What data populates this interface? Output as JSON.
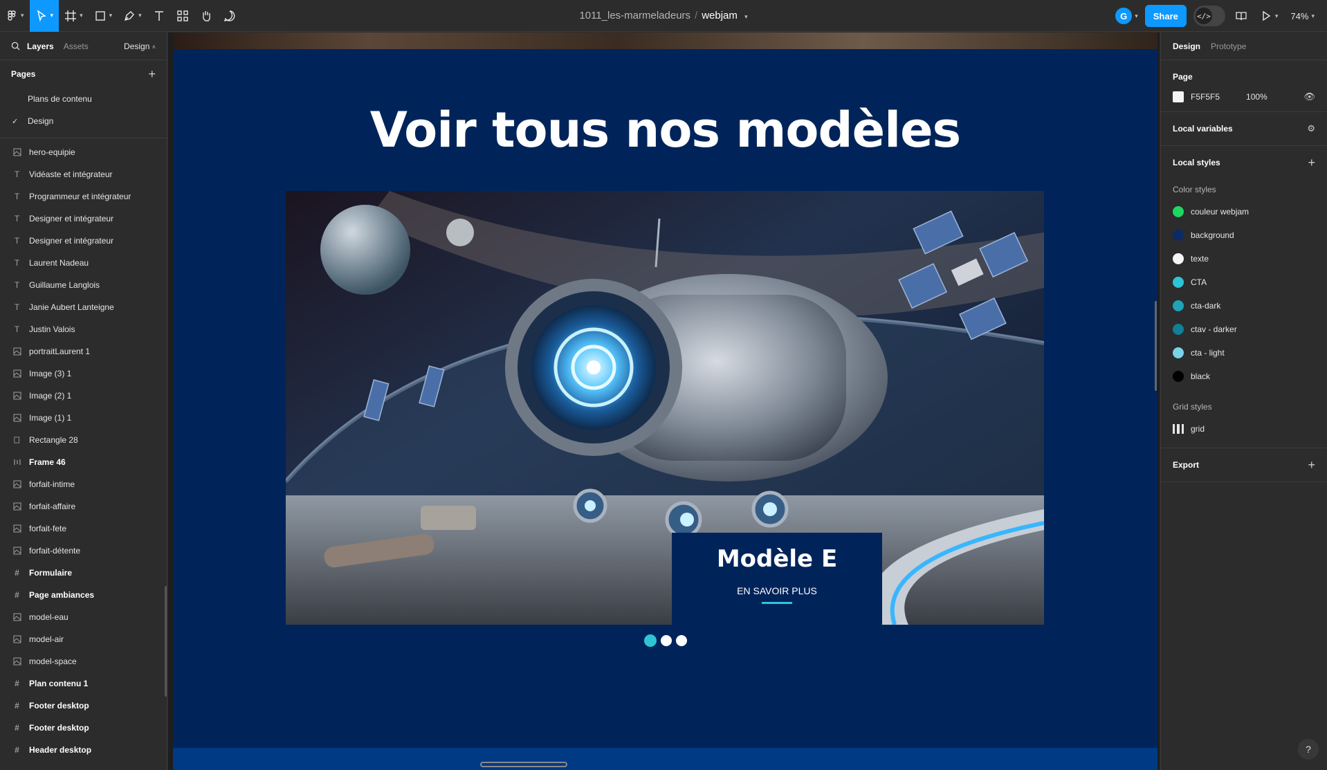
{
  "topbar": {
    "file_project": "1011_les-marmeladeurs",
    "file_name": "webjam",
    "user_initial": "G",
    "share_label": "Share",
    "zoom": "74%"
  },
  "left_panel": {
    "tabs": [
      "Layers",
      "Assets"
    ],
    "mode": "Design",
    "pages_title": "Pages",
    "pages": [
      {
        "label": "Plans de contenu",
        "current": false
      },
      {
        "label": "Design",
        "current": true
      }
    ],
    "layers": [
      {
        "label": "hero-equipie",
        "icon": "image-icon"
      },
      {
        "label": "Vidéaste et intégrateur",
        "icon": "text-icon"
      },
      {
        "label": "Programmeur et intégrateur",
        "icon": "text-icon"
      },
      {
        "label": "Designer et intégrateur",
        "icon": "text-icon"
      },
      {
        "label": "Designer et intégrateur",
        "icon": "text-icon"
      },
      {
        "label": "Laurent Nadeau",
        "icon": "text-icon"
      },
      {
        "label": "Guillaume Langlois",
        "icon": "text-icon"
      },
      {
        "label": "Janie Aubert Lanteigne",
        "icon": "text-icon"
      },
      {
        "label": "Justin Valois",
        "icon": "text-icon"
      },
      {
        "label": "portraitLaurent 1",
        "icon": "image-icon"
      },
      {
        "label": "Image (3) 1",
        "icon": "image-icon"
      },
      {
        "label": "Image (2) 1",
        "icon": "image-icon"
      },
      {
        "label": "Image (1) 1",
        "icon": "image-icon"
      },
      {
        "label": "Rectangle 28",
        "icon": "rectangle-icon"
      },
      {
        "label": "Frame 46",
        "icon": "autolayout-icon",
        "frame": true
      },
      {
        "label": "forfait-intime",
        "icon": "image-icon"
      },
      {
        "label": "forfait-affaire",
        "icon": "image-icon"
      },
      {
        "label": "forfait-fete",
        "icon": "image-icon"
      },
      {
        "label": "forfait-détente",
        "icon": "image-icon"
      },
      {
        "label": "Formulaire",
        "icon": "frame-icon",
        "frame": true
      },
      {
        "label": "Page ambiances",
        "icon": "frame-icon",
        "frame": true
      },
      {
        "label": "model-eau",
        "icon": "image-icon"
      },
      {
        "label": "model-air",
        "icon": "image-icon"
      },
      {
        "label": "model-space",
        "icon": "image-icon"
      },
      {
        "label": "Plan contenu 1",
        "icon": "frame-icon",
        "frame": true
      },
      {
        "label": "Footer desktop",
        "icon": "frame-icon",
        "frame": true
      },
      {
        "label": "Footer desktop",
        "icon": "frame-icon",
        "frame": true
      },
      {
        "label": "Header desktop",
        "icon": "frame-icon",
        "frame": true
      }
    ]
  },
  "canvas": {
    "headline": "Voir tous nos modèles",
    "card_title": "Modèle E",
    "card_link": "EN SAVOIR PLUS",
    "carousel_dots": 3,
    "active_dot": 0,
    "colors": {
      "background": "#00245a",
      "accent": "#2ec4d6",
      "footer": "#003a85"
    }
  },
  "right_panel": {
    "tabs": [
      "Design",
      "Prototype"
    ],
    "page_section": "Page",
    "page_color": "F5F5F5",
    "page_opacity": "100%",
    "local_variables": "Local variables",
    "local_styles": "Local styles",
    "color_styles_title": "Color styles",
    "color_styles": [
      {
        "name": "couleur webjam",
        "color": "#1ed760"
      },
      {
        "name": "background",
        "color": "#0b2a66"
      },
      {
        "name": "texte",
        "color": "#f5f5f5"
      },
      {
        "name": "CTA",
        "color": "#2ec4d6"
      },
      {
        "name": "cta-dark",
        "color": "#1fa3b8"
      },
      {
        "name": "ctav - darker",
        "color": "#117f95"
      },
      {
        "name": "cta - light",
        "color": "#7ad3e6"
      },
      {
        "name": "black",
        "color": "#000000"
      }
    ],
    "grid_styles_title": "Grid styles",
    "grid_styles": [
      {
        "name": "grid"
      }
    ],
    "export": "Export"
  }
}
